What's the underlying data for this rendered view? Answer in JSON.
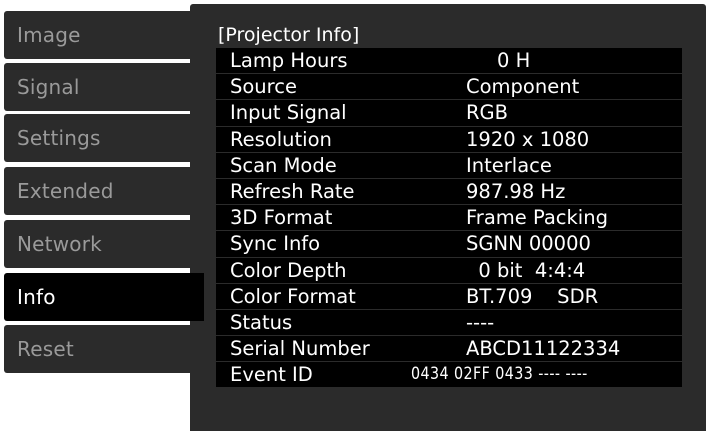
{
  "sidebar": {
    "items": [
      {
        "label": "Image"
      },
      {
        "label": "Signal"
      },
      {
        "label": "Settings"
      },
      {
        "label": "Extended"
      },
      {
        "label": "Network"
      },
      {
        "label": "Info"
      },
      {
        "label": "Reset"
      }
    ],
    "selected": "Info"
  },
  "panel": {
    "title": "[Projector Info]",
    "rows": [
      {
        "label": "Lamp Hours",
        "value": "     0 H"
      },
      {
        "label": "Source",
        "value": "Component"
      },
      {
        "label": "Input Signal",
        "value": "RGB"
      },
      {
        "label": "Resolution",
        "value": "1920 x 1080"
      },
      {
        "label": "Scan Mode",
        "value": "Interlace"
      },
      {
        "label": "Refresh Rate",
        "value": "987.98 Hz"
      },
      {
        "label": "3D Format",
        "value": "Frame Packing"
      },
      {
        "label": "Sync Info",
        "value": "SGNN 00000"
      },
      {
        "label": "Color Depth",
        "value": "  0 bit  4:4:4"
      },
      {
        "label": "Color Format",
        "value": "BT.709    SDR"
      },
      {
        "label": "Status",
        "value": "----"
      },
      {
        "label": "Serial Number",
        "value": "ABCD11122334"
      },
      {
        "label": "Event ID",
        "value": "0434 02FF 0433 ---- ----"
      }
    ]
  },
  "colors": {
    "selected_bg": "#000000",
    "item_bg": "#2b2b2b",
    "item_text": "#9a9a9a",
    "selected_text": "#ffffff"
  }
}
